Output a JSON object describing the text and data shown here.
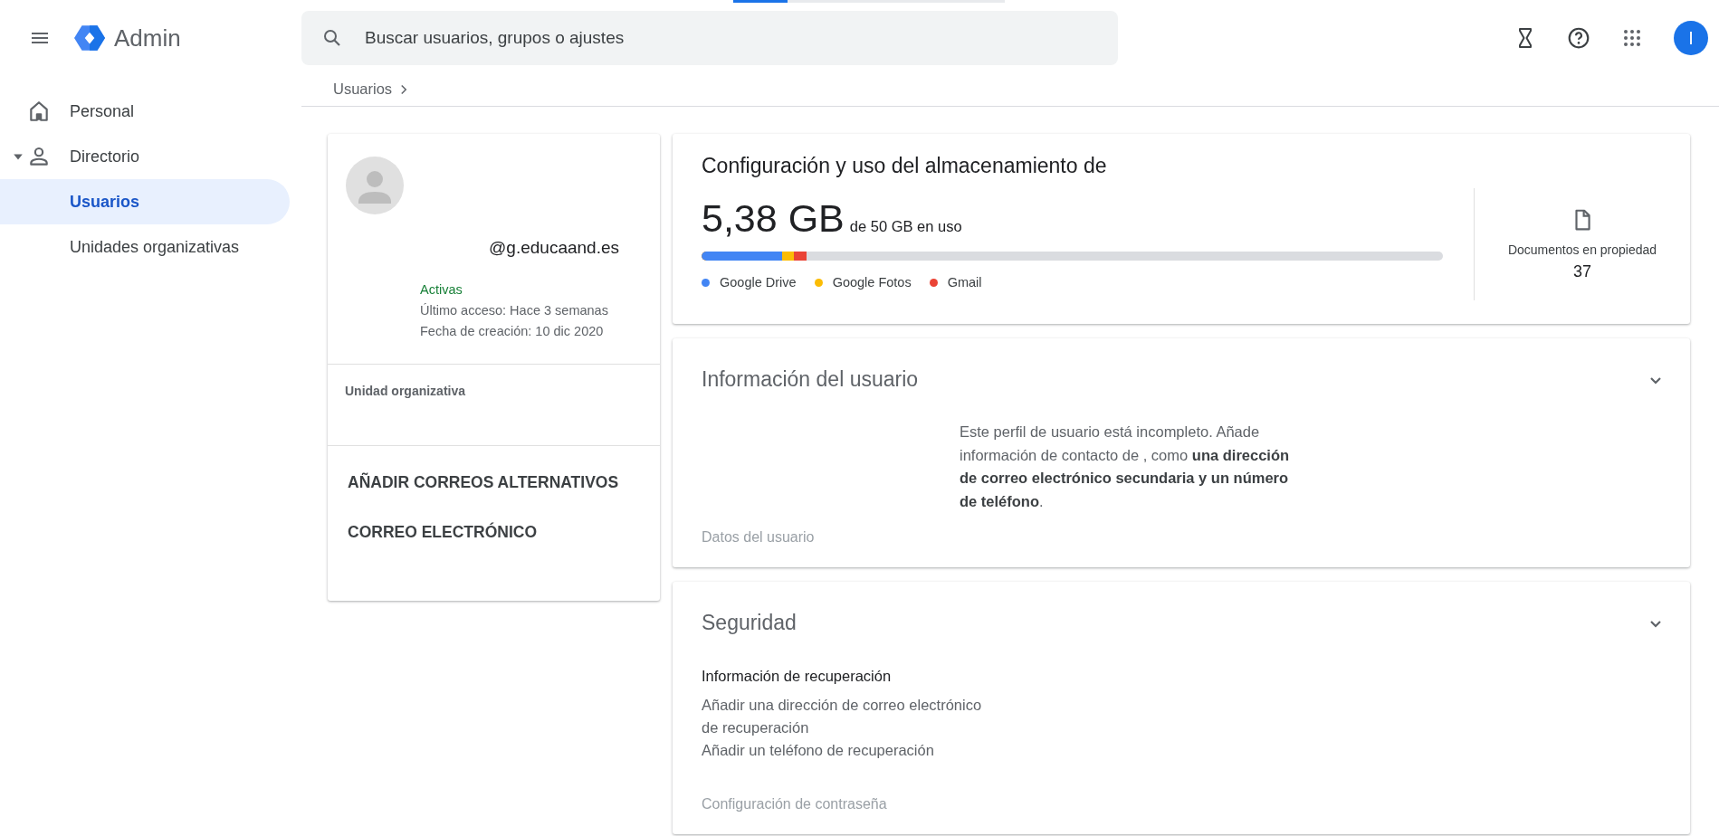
{
  "header": {
    "app_name": "Admin",
    "search": {
      "placeholder": "Buscar usuarios, grupos o ajustes"
    },
    "avatar_initial": "I"
  },
  "breadcrumb": [
    "Usuarios"
  ],
  "sidebar": {
    "items": [
      {
        "kind": "link",
        "label": "Personal",
        "selected": false
      },
      {
        "kind": "group",
        "label": "Directorio",
        "selected": false,
        "expanded": true,
        "children": [
          {
            "label": "Usuarios",
            "selected": true
          },
          {
            "label": "Unidades organizativas",
            "selected": false
          }
        ]
      }
    ]
  },
  "user_card": {
    "email": "@g.educaand.es",
    "status": "Activas",
    "last_access": "Último acceso: Hace 3 semanas",
    "created": "Fecha de creación: 10 dic 2020",
    "org_unit_label": "Unidad organizativa",
    "actions": [
      "AÑADIR CORREOS ALTERNATIVOS",
      "CORREO ELECTRÓNICO"
    ]
  },
  "storage": {
    "title": "Configuración y uso del almacenamiento de",
    "used": "5,38 GB",
    "quota": "de 50 GB en uso",
    "bar": [
      {
        "color": "#4285f4",
        "level": 0.109
      },
      {
        "color": "#fbbc04",
        "level": 0.124
      },
      {
        "color": "#ea4335",
        "level": 0.142
      }
    ],
    "legend": [
      {
        "name": "Google Drive",
        "color": "#4285f4"
      },
      {
        "name": "Google Fotos",
        "color": "#fbbc04"
      },
      {
        "name": "Gmail",
        "color": "#ea4335"
      }
    ],
    "documents": {
      "label": "Documentos en propiedad",
      "count": "37"
    }
  },
  "user_info": {
    "title": "Información del usuario",
    "message": "Este perfil de usuario está incompleto. Añade información de contacto de , como **una dirección de correo electrónico secundaria y un número de teléfono**.",
    "footer": "Datos del usuario"
  },
  "security": {
    "title": "Seguridad",
    "recovery_title": "Información de recuperación",
    "recovery_lines": [
      "Añadir una dirección de correo electrónico de recuperación",
      "Añadir un teléfono de recuperación"
    ],
    "footer": "Configuración de contraseña"
  }
}
